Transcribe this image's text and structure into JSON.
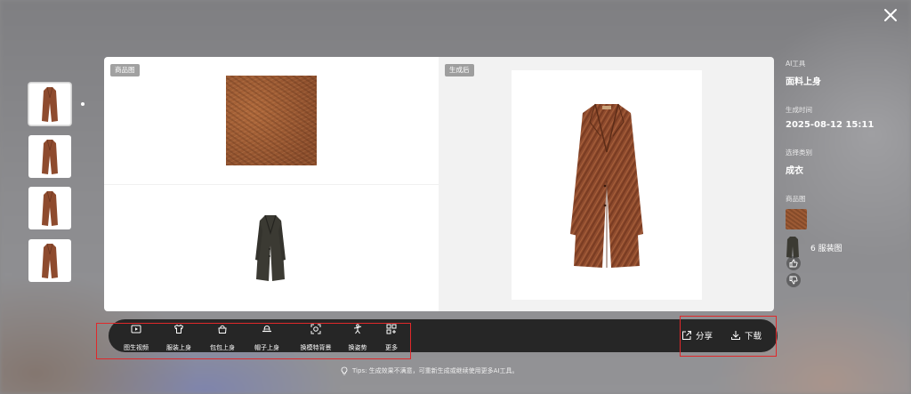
{
  "left_panel": {
    "tag": "商品图"
  },
  "right_panel": {
    "tag": "生成后"
  },
  "info": {
    "tool_label": "AI工具",
    "tool_value": "面料上身",
    "time_label": "生成时间",
    "time_value": "2025-08-12 15:11",
    "category_label": "选择类别",
    "category_value": "成衣",
    "product_label": "商品图",
    "garment_count": "6",
    "garment_label": "服装图"
  },
  "toolbar": {
    "tools": [
      {
        "label": "图生视频",
        "icon": "video-icon"
      },
      {
        "label": "服装上身",
        "icon": "shirt-icon"
      },
      {
        "label": "包包上身",
        "icon": "bag-icon"
      },
      {
        "label": "帽子上身",
        "icon": "hat-icon"
      },
      {
        "label": "换模特背景",
        "icon": "scan-face-icon"
      },
      {
        "label": "换姿势",
        "icon": "pose-icon"
      },
      {
        "label": "更多",
        "icon": "grid-plus-icon"
      }
    ],
    "share_label": "分享",
    "download_label": "下载"
  },
  "tips": "Tips: 生成效果不满意，可重新生成或继续使用更多AI工具。",
  "colors": {
    "coat_brown": "#8e4b2e",
    "toolbar_bg": "#262626",
    "highlight_red": "#e0282a"
  }
}
